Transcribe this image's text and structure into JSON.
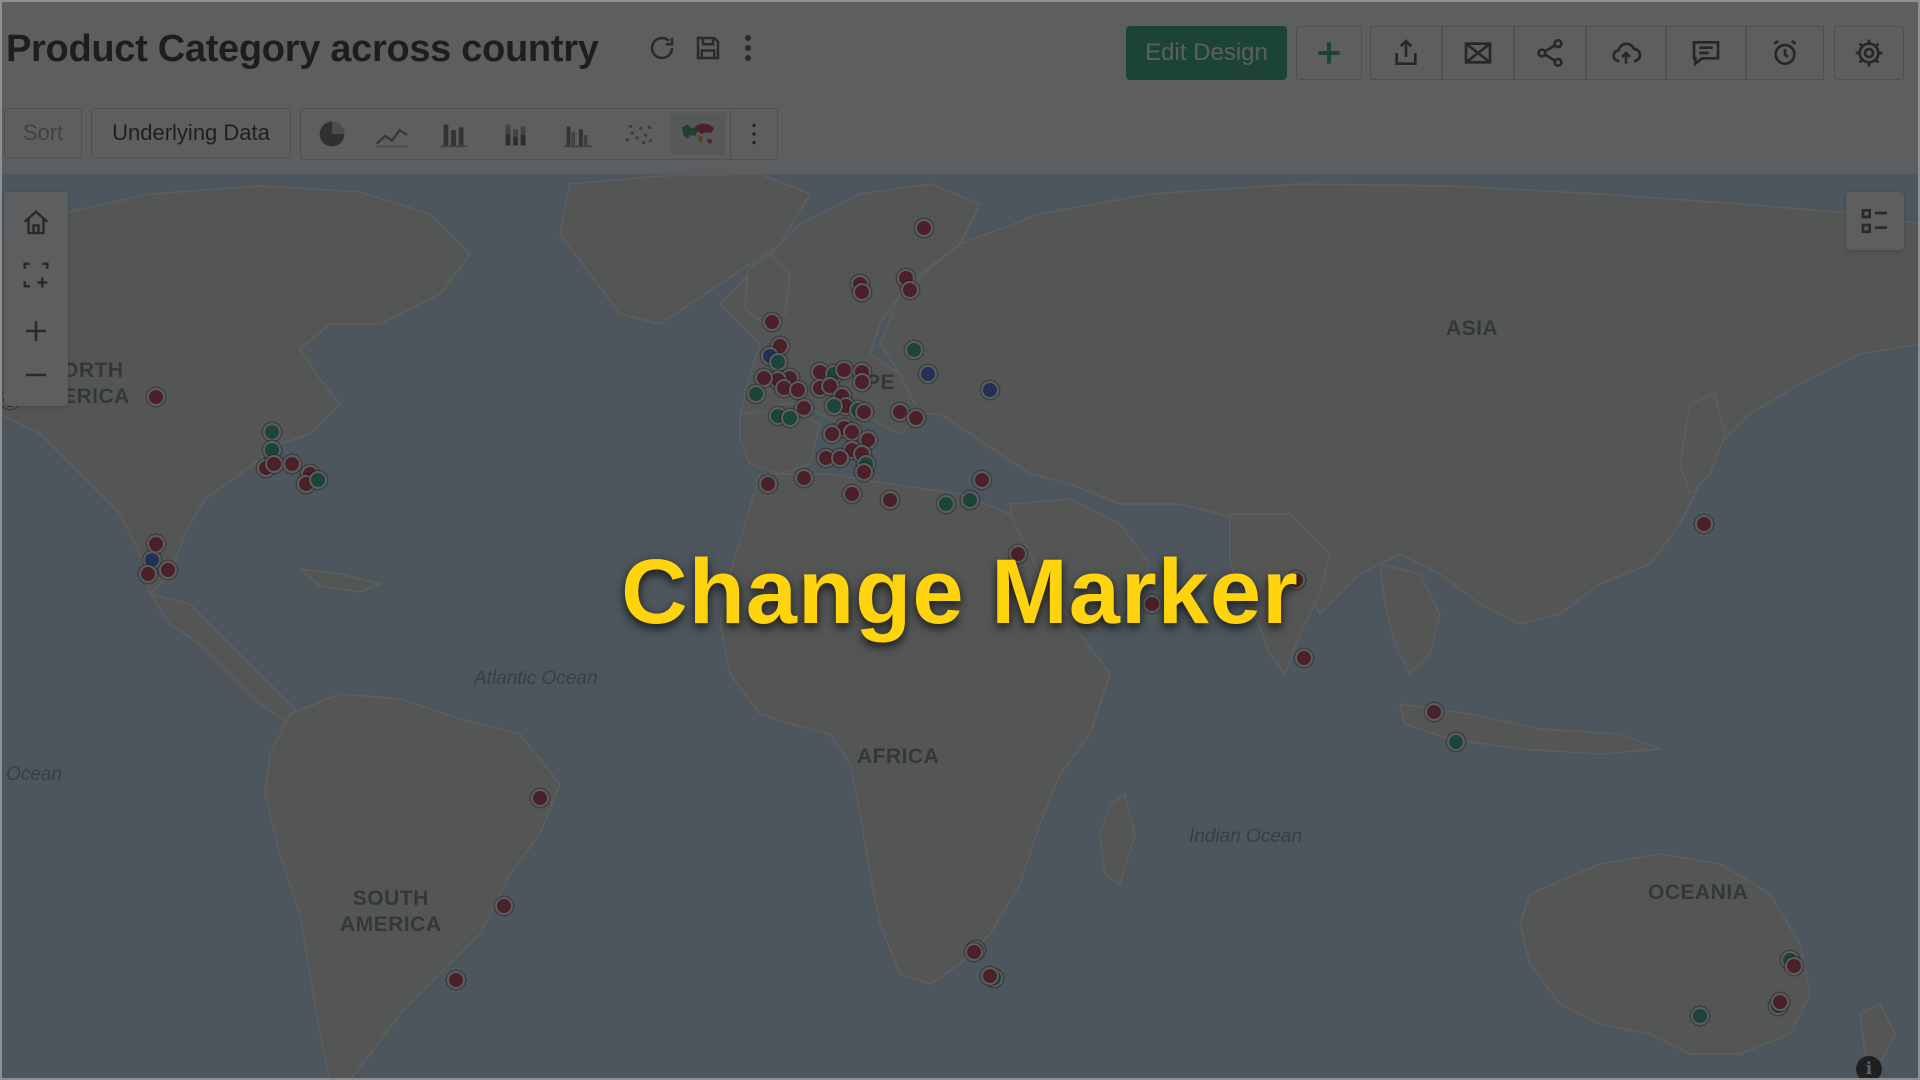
{
  "header": {
    "title": "Product Category across country",
    "edit_design_label": "Edit Design"
  },
  "toolbar": {
    "sort_label": "Sort",
    "underlying_data_label": "Underlying Data",
    "chart_types": [
      "pie-chart-icon",
      "line-chart-icon",
      "bar-chart-icon",
      "stacked-bar-icon",
      "grouped-bar-icon",
      "scatter-icon",
      "geo-map-icon"
    ],
    "active_chart_type": "geo-map-icon"
  },
  "map": {
    "continent_labels": {
      "north_america": "ORTH\nERICA",
      "europe": "PE",
      "asia": "ASIA",
      "africa": "AFRICA",
      "south_america": "SOUTH\nAMERICA",
      "oceania": "OCEANIA"
    },
    "ocean_labels": {
      "atlantic": "Atlantic Ocean",
      "pacific_left": "Ocean",
      "indian": "Indian Ocean"
    },
    "colors": {
      "crimson": "#c0233f",
      "green": "#1aa079",
      "blue": "#2c62cf"
    }
  },
  "overlay": {
    "caption": "Change Marker"
  }
}
